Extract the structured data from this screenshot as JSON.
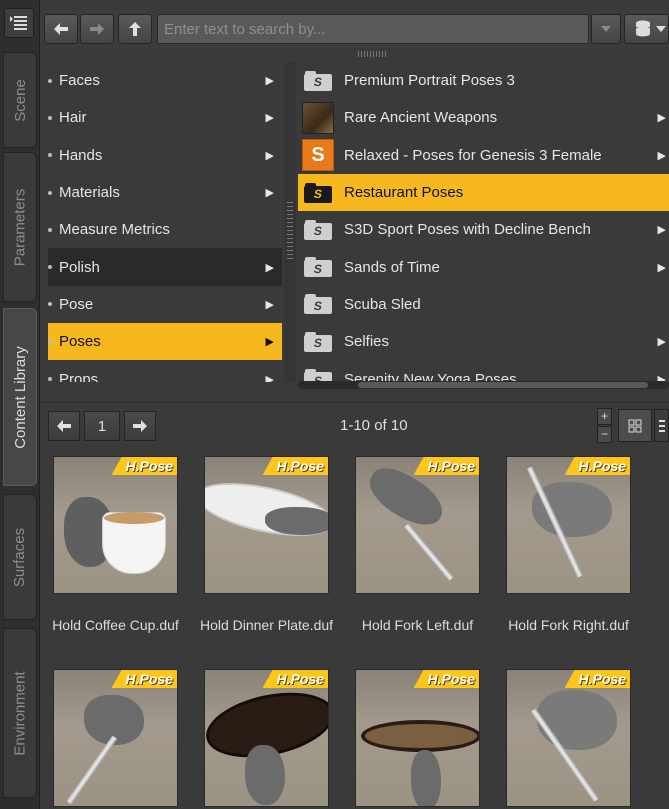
{
  "side_tabs": [
    {
      "label": "Scene",
      "active": false
    },
    {
      "label": "Parameters",
      "active": false
    },
    {
      "label": "Content Library",
      "active": true
    },
    {
      "label": "Surfaces",
      "active": false
    },
    {
      "label": "Environment",
      "active": false
    }
  ],
  "toolbar": {
    "search_placeholder": "Enter text to search by...",
    "back_icon": "arrow-left-icon",
    "forward_icon": "arrow-right-icon",
    "up_icon": "up-arrow-icon"
  },
  "categories": [
    {
      "label": "Faces",
      "has_children": true,
      "state": "normal"
    },
    {
      "label": "Hair",
      "has_children": true,
      "state": "normal"
    },
    {
      "label": "Hands",
      "has_children": true,
      "state": "normal"
    },
    {
      "label": "Materials",
      "has_children": true,
      "state": "normal"
    },
    {
      "label": "Measure Metrics",
      "has_children": false,
      "state": "normal"
    },
    {
      "label": "Polish",
      "has_children": true,
      "state": "dark"
    },
    {
      "label": "Pose",
      "has_children": true,
      "state": "normal"
    },
    {
      "label": "Poses",
      "has_children": true,
      "state": "selected"
    },
    {
      "label": "Props",
      "has_children": true,
      "state": "normal"
    }
  ],
  "products": [
    {
      "label": "Premium Portrait Poses 3",
      "icon": "folder",
      "has_children": false,
      "selected": false
    },
    {
      "label": "Rare Ancient Weapons",
      "icon": "thumb-weapons",
      "has_children": true,
      "selected": false
    },
    {
      "label": "Relaxed - Poses for Genesis 3 Female",
      "icon": "thumb-relaxed",
      "has_children": true,
      "selected": false
    },
    {
      "label": "Restaurant Poses",
      "icon": "folder",
      "has_children": false,
      "selected": true
    },
    {
      "label": "S3D Sport Poses with Decline Bench",
      "icon": "folder",
      "has_children": true,
      "selected": false
    },
    {
      "label": "Sands of Time",
      "icon": "folder",
      "has_children": true,
      "selected": false
    },
    {
      "label": "Scuba Sled",
      "icon": "folder",
      "has_children": false,
      "selected": false
    },
    {
      "label": "Selfies",
      "icon": "folder",
      "has_children": true,
      "selected": false
    },
    {
      "label": "Serenity New Yoga Poses",
      "icon": "folder",
      "has_children": true,
      "selected": false
    }
  ],
  "pager": {
    "page": "1",
    "range_text": "1-10 of 10"
  },
  "assets": [
    {
      "badge": "H.Pose",
      "name": "Hold Coffee Cup.duf",
      "prop": "cup"
    },
    {
      "badge": "H.Pose",
      "name": "Hold Dinner Plate.duf",
      "prop": "plate"
    },
    {
      "badge": "H.Pose",
      "name": "Hold Fork Left.duf",
      "prop": "fork-left"
    },
    {
      "badge": "H.Pose",
      "name": "Hold Fork Right.duf",
      "prop": "fork-right"
    },
    {
      "badge": "H.Pose",
      "name": "",
      "prop": "knife"
    },
    {
      "badge": "H.Pose",
      "name": "",
      "prop": "tray-dark"
    },
    {
      "badge": "H.Pose",
      "name": "",
      "prop": "tray-light"
    },
    {
      "badge": "H.Pose",
      "name": "",
      "prop": "spoon"
    }
  ],
  "colors": {
    "accent": "#f6b81e",
    "badge": "#ffc61a",
    "panel": "#3a3a3a"
  }
}
